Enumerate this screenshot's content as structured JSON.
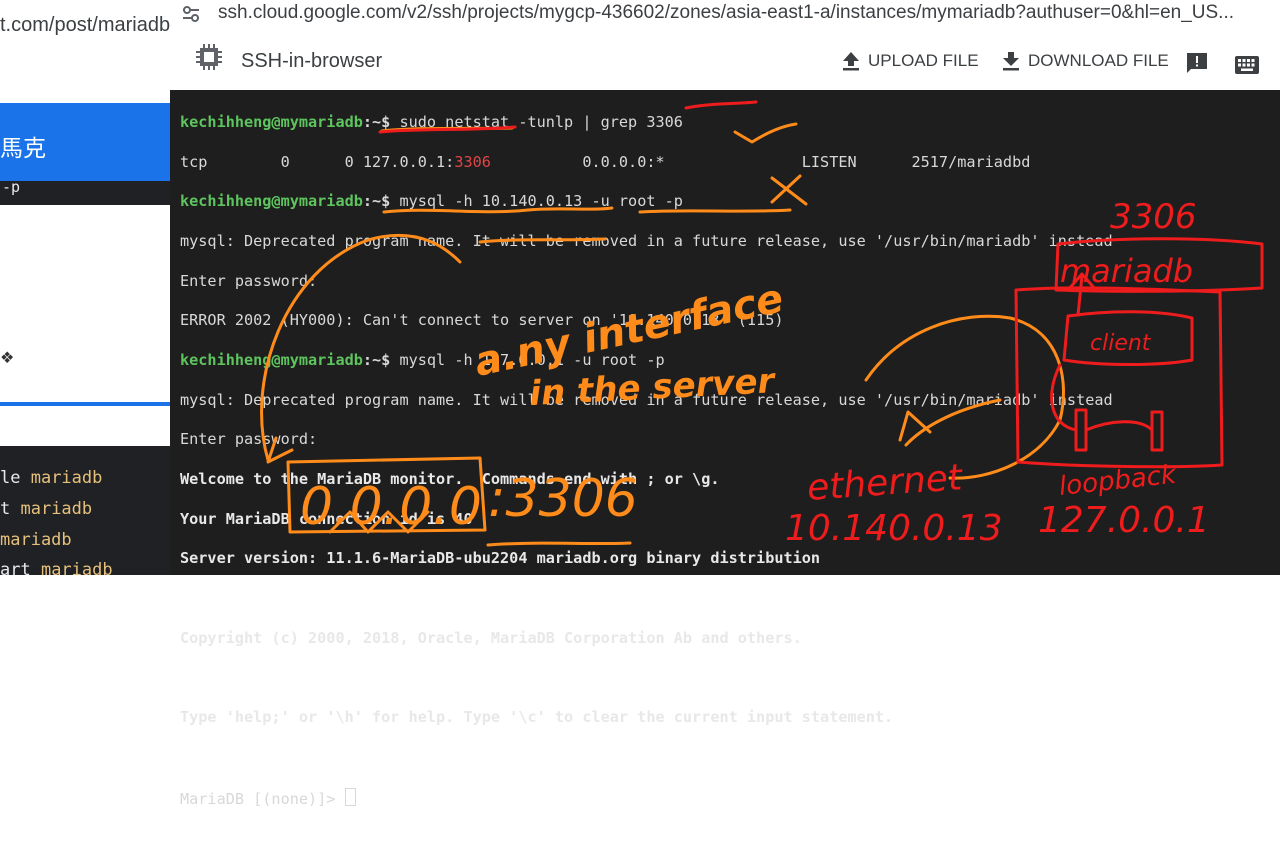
{
  "background_window": {
    "url_fragment": "t.com/post/mariadb",
    "banner_text": "馬克",
    "terminal_fragment": "-p",
    "star_glyph": "❖",
    "code_lines": [
      {
        "pre": "le",
        "kw": " mariadb"
      },
      {
        "pre": "t",
        "kw": " mariadb"
      },
      {
        "pre": "",
        "kw": " mariadb"
      },
      {
        "pre": "art",
        "kw": " mariadb"
      }
    ]
  },
  "browser": {
    "url": "ssh.cloud.google.com/v2/ssh/projects/mygcp-436602/zones/asia-east1-a/instances/mymariadb?authuser=0&hl=en_US..."
  },
  "app": {
    "title": "SSH-in-browser",
    "upload_label": "UPLOAD FILE",
    "download_label": "DOWNLOAD FILE",
    "icons": {
      "app": "chip-icon",
      "upload": "upload-icon",
      "download": "download-icon",
      "feedback": "feedback-icon",
      "keyboard": "keyboard-icon"
    }
  },
  "terminal": {
    "prompt_user": "kechihheng@mymariadb",
    "prompt_path": ":~$",
    "lines": {
      "l1_cmd": " sudo netstat -tunlp | grep 3306",
      "l2_pre": "tcp        0      0 127.0.0.1:",
      "l2_port": "3306",
      "l2_post": "          0.0.0.0:*               LISTEN      2517/mariadbd",
      "l3_cmd": " mysql -h 10.140.0.13 -u root -p",
      "l4": "mysql: Deprecated program name. It will be removed in a future release, use '/usr/bin/mariadb' instead",
      "l5": "Enter password:",
      "l6": "ERROR 2002 (HY000): Can't connect to server on '10.140.0.13' (115)",
      "l7_cmd": " mysql -h 127.0.0.1 -u root -p",
      "l8": "mysql: Deprecated program name. It will be removed in a future release, use '/usr/bin/mariadb' instead",
      "l9": "Enter password:",
      "l10": "Welcome to the MariaDB monitor.  Commands end with ; or \\g.",
      "l11": "Your MariaDB connection id is 40",
      "l12": "Server version: 11.1.6-MariaDB-ubu2204 mariadb.org binary distribution",
      "l14": "Copyright (c) 2000, 2018, Oracle, MariaDB Corporation Ab and others.",
      "l16": "Type 'help;' or '\\h' for help. Type '\\c' to clear the current input statement.",
      "l18_prompt": "MariaDB [(none)]> "
    }
  },
  "annotations": {
    "orange_color": "#ff8c1a",
    "red_color": "#ee1c1c",
    "any_interface": "a.ny interface",
    "in_the_server": "in the server",
    "bind_address": "0.0.0.0",
    "bind_port": ":3306",
    "port_label": "3306",
    "db_label": "mariadb",
    "client_label": "client",
    "ethernet_label": "ethernet",
    "ethernet_ip": "10.140.0.13",
    "loopback_label": "loopback",
    "loopback_ip": "127.0.0.1"
  }
}
